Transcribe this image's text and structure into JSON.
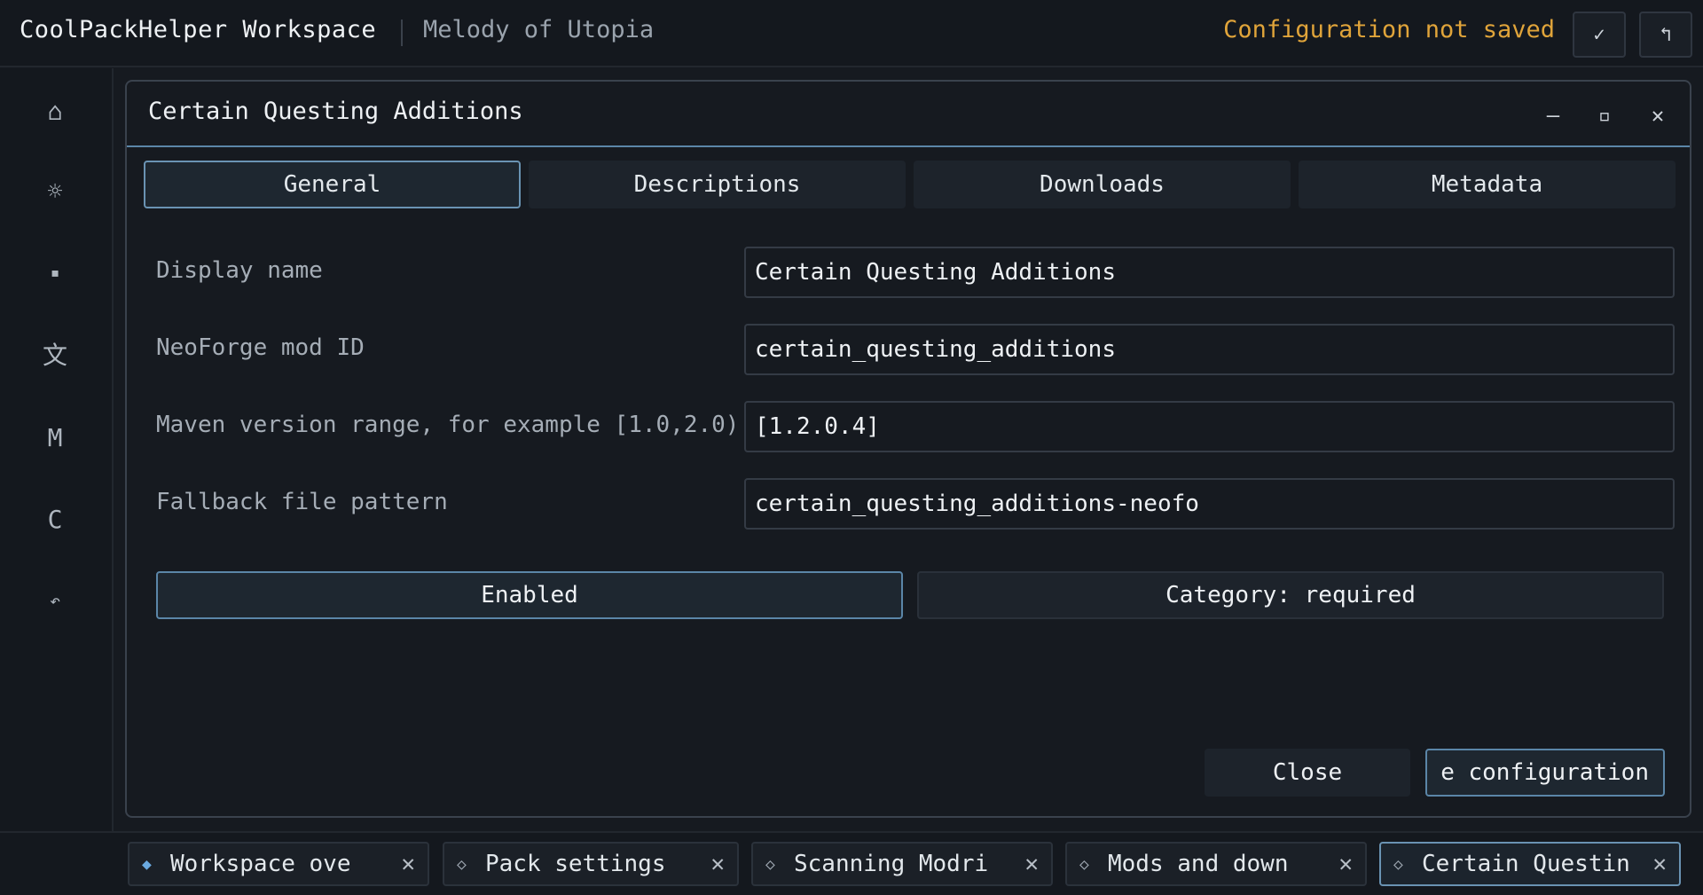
{
  "header": {
    "app_title": "CoolPackHelper Workspace",
    "pack_name": "Melody of Utopia",
    "status": "Configuration not saved",
    "save_icon": "✓",
    "exit_icon": "↰"
  },
  "sidebar": {
    "items": [
      {
        "name": "home-icon",
        "glyph": "⌂"
      },
      {
        "name": "settings-icon",
        "glyph": "☼"
      },
      {
        "name": "mods-icon",
        "glyph": "▪"
      },
      {
        "name": "language-icon",
        "glyph": "文"
      },
      {
        "name": "modrinth-icon",
        "glyph": "M"
      },
      {
        "name": "curseforge-icon",
        "glyph": "C"
      },
      {
        "name": "back-icon",
        "glyph": "↶"
      }
    ]
  },
  "dialog": {
    "title": "Certain Questing Additions",
    "controls": {
      "minimize": "—",
      "maximize": "▫",
      "close": "✕"
    },
    "tabs": [
      "General",
      "Descriptions",
      "Downloads",
      "Metadata"
    ],
    "fields": [
      {
        "label": "Display name",
        "value": "Certain Questing Additions"
      },
      {
        "label": "NeoForge mod ID",
        "value": "certain_questing_additions"
      },
      {
        "label": "Maven version range, for example [1.0,2.0)",
        "value": "[1.2.0.4]"
      },
      {
        "label": "Fallback file pattern",
        "value": "certain_questing_additions-neofo"
      }
    ],
    "enabled_label": "Enabled",
    "category_label": "Category: required",
    "close_label": "Close",
    "save_label": "e configuration"
  },
  "taskbar": {
    "tabs": [
      {
        "label": "Workspace ove",
        "icon": "◆",
        "close": "✕"
      },
      {
        "label": "Pack settings",
        "icon": "◇",
        "close": "✕"
      },
      {
        "label": "Scanning Modri",
        "icon": "◇",
        "close": "✕"
      },
      {
        "label": "Mods and down",
        "icon": "◇",
        "close": "✕"
      },
      {
        "label": "Certain Questin",
        "icon": "◇",
        "close": "✕"
      }
    ]
  }
}
